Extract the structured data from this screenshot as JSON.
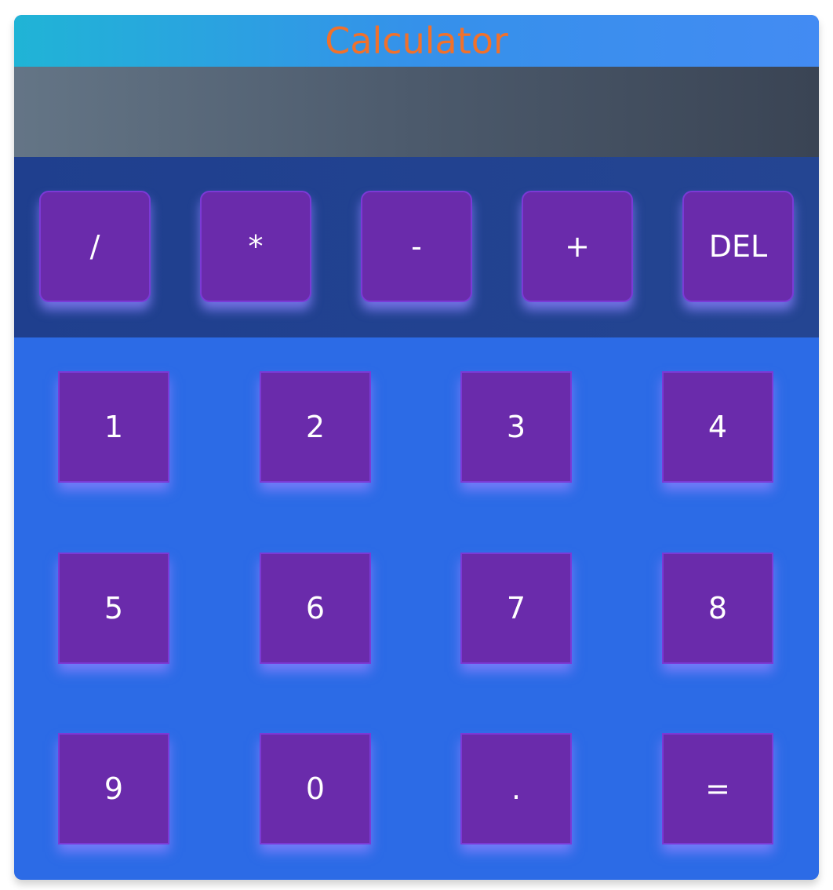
{
  "title": "Calculator",
  "display": {
    "value": ""
  },
  "operators": [
    "/",
    "*",
    "-",
    "+",
    "DEL"
  ],
  "keys": [
    "1",
    "2",
    "3",
    "4",
    "5",
    "6",
    "7",
    "8",
    "9",
    "0",
    ".",
    "="
  ],
  "colors": {
    "title_text": "#f0712c",
    "button": "#6a2bab",
    "keypad_bg": "#2c6be6",
    "operator_bg": "#1f3f8e"
  }
}
